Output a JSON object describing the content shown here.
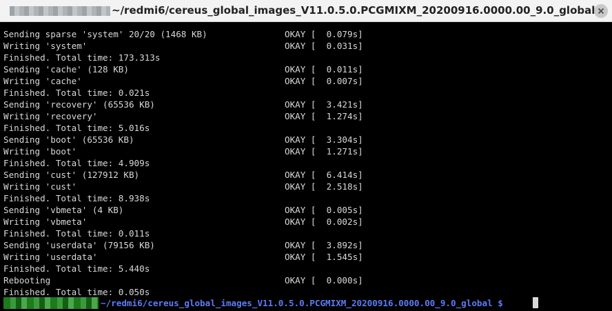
{
  "window": {
    "title": "~/redmi6/cereus_global_images_V11.0.5.0.PCGMIXM_20200916.0000.00_9.0_global"
  },
  "terminal": {
    "lines": [
      {
        "text": "Sending sparse 'system' 20/20 (1468 KB)",
        "status": "OKAY [  0.079s]"
      },
      {
        "text": "Writing 'system'",
        "status": "OKAY [  0.031s]"
      },
      {
        "text": "Finished. Total time: 173.313s",
        "status": ""
      },
      {
        "text": "Sending 'cache' (128 KB)",
        "status": "OKAY [  0.011s]"
      },
      {
        "text": "Writing 'cache'",
        "status": "OKAY [  0.007s]"
      },
      {
        "text": "Finished. Total time: 0.021s",
        "status": ""
      },
      {
        "text": "Sending 'recovery' (65536 KB)",
        "status": "OKAY [  3.421s]"
      },
      {
        "text": "Writing 'recovery'",
        "status": "OKAY [  1.274s]"
      },
      {
        "text": "Finished. Total time: 5.016s",
        "status": ""
      },
      {
        "text": "Sending 'boot' (65536 KB)",
        "status": "OKAY [  3.304s]"
      },
      {
        "text": "Writing 'boot'",
        "status": "OKAY [  1.271s]"
      },
      {
        "text": "Finished. Total time: 4.909s",
        "status": ""
      },
      {
        "text": "Sending 'cust' (127912 KB)",
        "status": "OKAY [  6.414s]"
      },
      {
        "text": "Writing 'cust'",
        "status": "OKAY [  2.518s]"
      },
      {
        "text": "Finished. Total time: 8.938s",
        "status": ""
      },
      {
        "text": "Sending 'vbmeta' (4 KB)",
        "status": "OKAY [  0.005s]"
      },
      {
        "text": "Writing 'vbmeta'",
        "status": "OKAY [  0.002s]"
      },
      {
        "text": "Finished. Total time: 0.011s",
        "status": ""
      },
      {
        "text": "Sending 'userdata' (79156 KB)",
        "status": "OKAY [  3.892s]"
      },
      {
        "text": "Writing 'userdata'",
        "status": "OKAY [  1.545s]"
      },
      {
        "text": "Finished. Total time: 5.440s",
        "status": ""
      },
      {
        "text": "Rebooting",
        "status": "OKAY [  0.000s]"
      },
      {
        "text": "Finished. Total time: 0.050s",
        "status": ""
      }
    ],
    "prompt": "~/redmi6/cereus_global_images_V11.0.5.0.PCGMIXM_20200916.0000.00_9.0_global $"
  },
  "colors": {
    "prompt_path": "#5c7cf6",
    "terminal_bg": "#000000",
    "terminal_fg": "#d9d9d9"
  }
}
